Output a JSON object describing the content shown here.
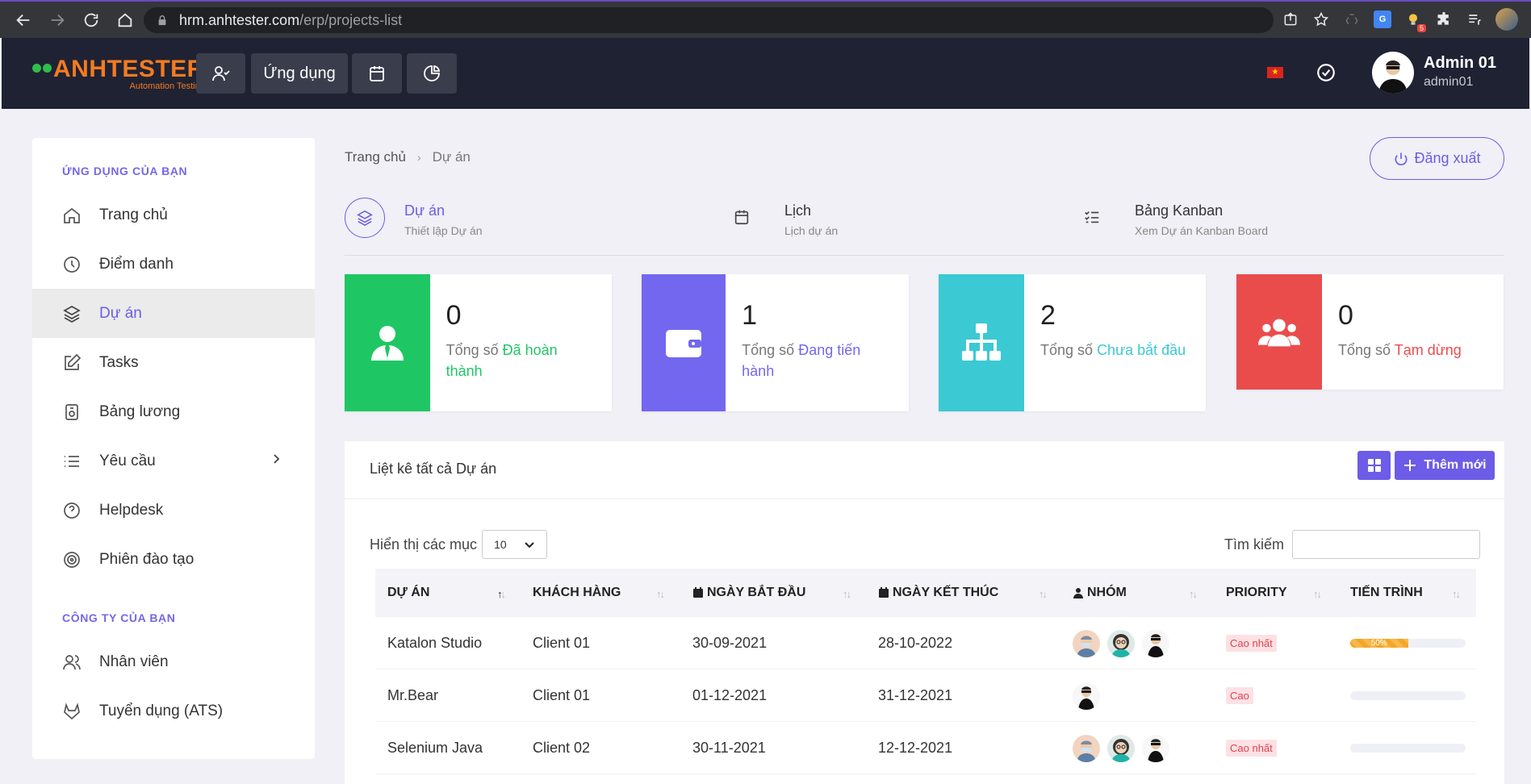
{
  "browser": {
    "url_host": "hrm.anhtester.com",
    "url_path": "/erp/projects-list",
    "ext_badge": "5"
  },
  "header": {
    "logo_text": "ANHTESTER",
    "logo_tagline": "Automation Testing",
    "apps_label": "Ứng dụng",
    "user_name": "Admin 01",
    "user_login": "admin01",
    "flag_star": "★"
  },
  "sidebar": {
    "section_apps": "ỨNG DỤNG CỦA BẠN",
    "section_company": "CÔNG TY CỦA BẠN",
    "items": [
      {
        "label": "Trang chủ"
      },
      {
        "label": "Điểm danh"
      },
      {
        "label": "Dự án"
      },
      {
        "label": "Tasks"
      },
      {
        "label": "Bảng lương"
      },
      {
        "label": "Yêu cầu"
      },
      {
        "label": "Helpdesk"
      },
      {
        "label": "Phiên đào tạo"
      },
      {
        "label": "Nhân viên"
      },
      {
        "label": "Tuyển dụng (ATS)"
      }
    ]
  },
  "breadcrumb": {
    "home": "Trang chủ",
    "sep": "›",
    "current": "Dự án"
  },
  "logout_label": "Đăng xuất",
  "tabs": [
    {
      "title": "Dự án",
      "subtitle": "Thiết lập Dự án"
    },
    {
      "title": "Lịch",
      "subtitle": "Lịch dự án"
    },
    {
      "title": "Bảng Kanban",
      "subtitle": "Xem Dự án Kanban Board"
    }
  ],
  "stats": [
    {
      "value": "0",
      "prefix": "Tổng số",
      "label": "Đã hoàn thành",
      "color": "#1ec764"
    },
    {
      "value": "1",
      "prefix": "Tổng số",
      "label": "Đang tiến hành",
      "color": "#7367f0"
    },
    {
      "value": "2",
      "prefix": "Tổng số",
      "label": "Chưa bắt đầu",
      "color": "#3bc9d3"
    },
    {
      "value": "0",
      "prefix": "Tổng số",
      "label": "Tạm dừng",
      "color": "#ea4c4c"
    }
  ],
  "panel": {
    "title": "Liệt kê tất cả Dự án",
    "add_label": "Thêm mới",
    "show_label": "Hiển thị các mục",
    "page_size": "10",
    "search_label": "Tìm kiếm",
    "search_value": ""
  },
  "table": {
    "columns": [
      "DỰ ÁN",
      "KHÁCH HÀNG",
      "NGÀY BẮT ĐẦU",
      "NGÀY KẾT THÚC",
      "NHÓM",
      "PRIORITY",
      "TIẾN TRÌNH"
    ],
    "rows": [
      {
        "project": "Katalon Studio",
        "client": "Client 01",
        "start": "30-09-2021",
        "end": "28-10-2022",
        "team_count": 3,
        "priority": "Cao nhất",
        "progress": 50,
        "progress_label": "50%"
      },
      {
        "project": "Mr.Bear",
        "client": "Client 01",
        "start": "01-12-2021",
        "end": "31-12-2021",
        "team_count": 1,
        "priority": "Cao",
        "progress": 0,
        "progress_label": ""
      },
      {
        "project": "Selenium Java",
        "client": "Client 02",
        "start": "30-11-2021",
        "end": "12-12-2021",
        "team_count": 3,
        "priority": "Cao nhất",
        "progress": 0,
        "progress_label": ""
      }
    ]
  }
}
